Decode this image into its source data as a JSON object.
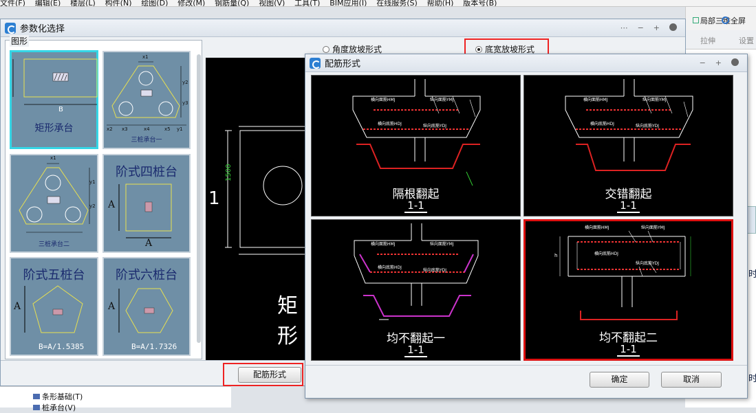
{
  "menu": [
    "文件(F)",
    "编辑(E)",
    "楼层(L)",
    "构件(N)",
    "绘图(D)",
    "修改(M)",
    "钢筋量(Q)",
    "视图(V)",
    "工具(T)",
    "BIM应用(I)",
    "在线服务(S)",
    "帮助(H)",
    "版本号(B)"
  ],
  "bg_toolbar": {
    "view3d": "局部三维",
    "fullscreen": "全屏",
    "stretch": "拉伸",
    "settings": "设置"
  },
  "param_dialog": {
    "title": "参数化选择",
    "group_label": "图形",
    "thumbs": [
      {
        "caption": "矩形承台",
        "label_b": "B",
        "selected": true
      },
      {
        "caption": "三桩承台一",
        "labels": [
          "x1",
          "x2",
          "x3",
          "x4",
          "x5",
          "y1",
          "y2",
          "y3"
        ]
      },
      {
        "caption": "三桩承台二",
        "labels": [
          "x1",
          "y1",
          "y2"
        ]
      },
      {
        "caption": "阶式四桩台",
        "label_a": "A"
      },
      {
        "caption": "阶式五桩台",
        "formula": "B=A/1.5385",
        "label_a": "A"
      },
      {
        "caption": "阶式六桩台",
        "formula": "B=A/1.7326",
        "label_a": "A"
      }
    ],
    "radio_options": [
      {
        "label": "角度放坡形式",
        "checked": false
      },
      {
        "label": "底宽放坡形式",
        "checked": true
      }
    ],
    "preview": {
      "dim": "1500",
      "section": "1",
      "partial_title": "矩形"
    },
    "rebar_button": "配筋形式"
  },
  "rebar_dialog": {
    "title": "配筋形式",
    "options": [
      {
        "label": "隔根翻起",
        "section": "1-1",
        "selected": false
      },
      {
        "label": "交错翻起",
        "section": "1-1",
        "selected": false
      },
      {
        "label": "均不翻起一",
        "section": "1-1",
        "selected": false
      },
      {
        "label": "均不翻起二",
        "section": "1-1",
        "selected": true
      }
    ],
    "ann": {
      "top_h": "横向面筋",
      "top_v": "纵向面筋",
      "bot_h": "横向底筋",
      "bot_v": "纵向底筋",
      "hmj": "HMJ",
      "ymj": "YMJ",
      "hdj": "HDJ",
      "ydj": "YDJ",
      "h": "h"
    },
    "ok": "确定",
    "cancel": "取消"
  },
  "tree": {
    "items": [
      "条形基础(T)",
      "桩承台(V)"
    ]
  },
  "side_text": [
    "时",
    "时"
  ]
}
